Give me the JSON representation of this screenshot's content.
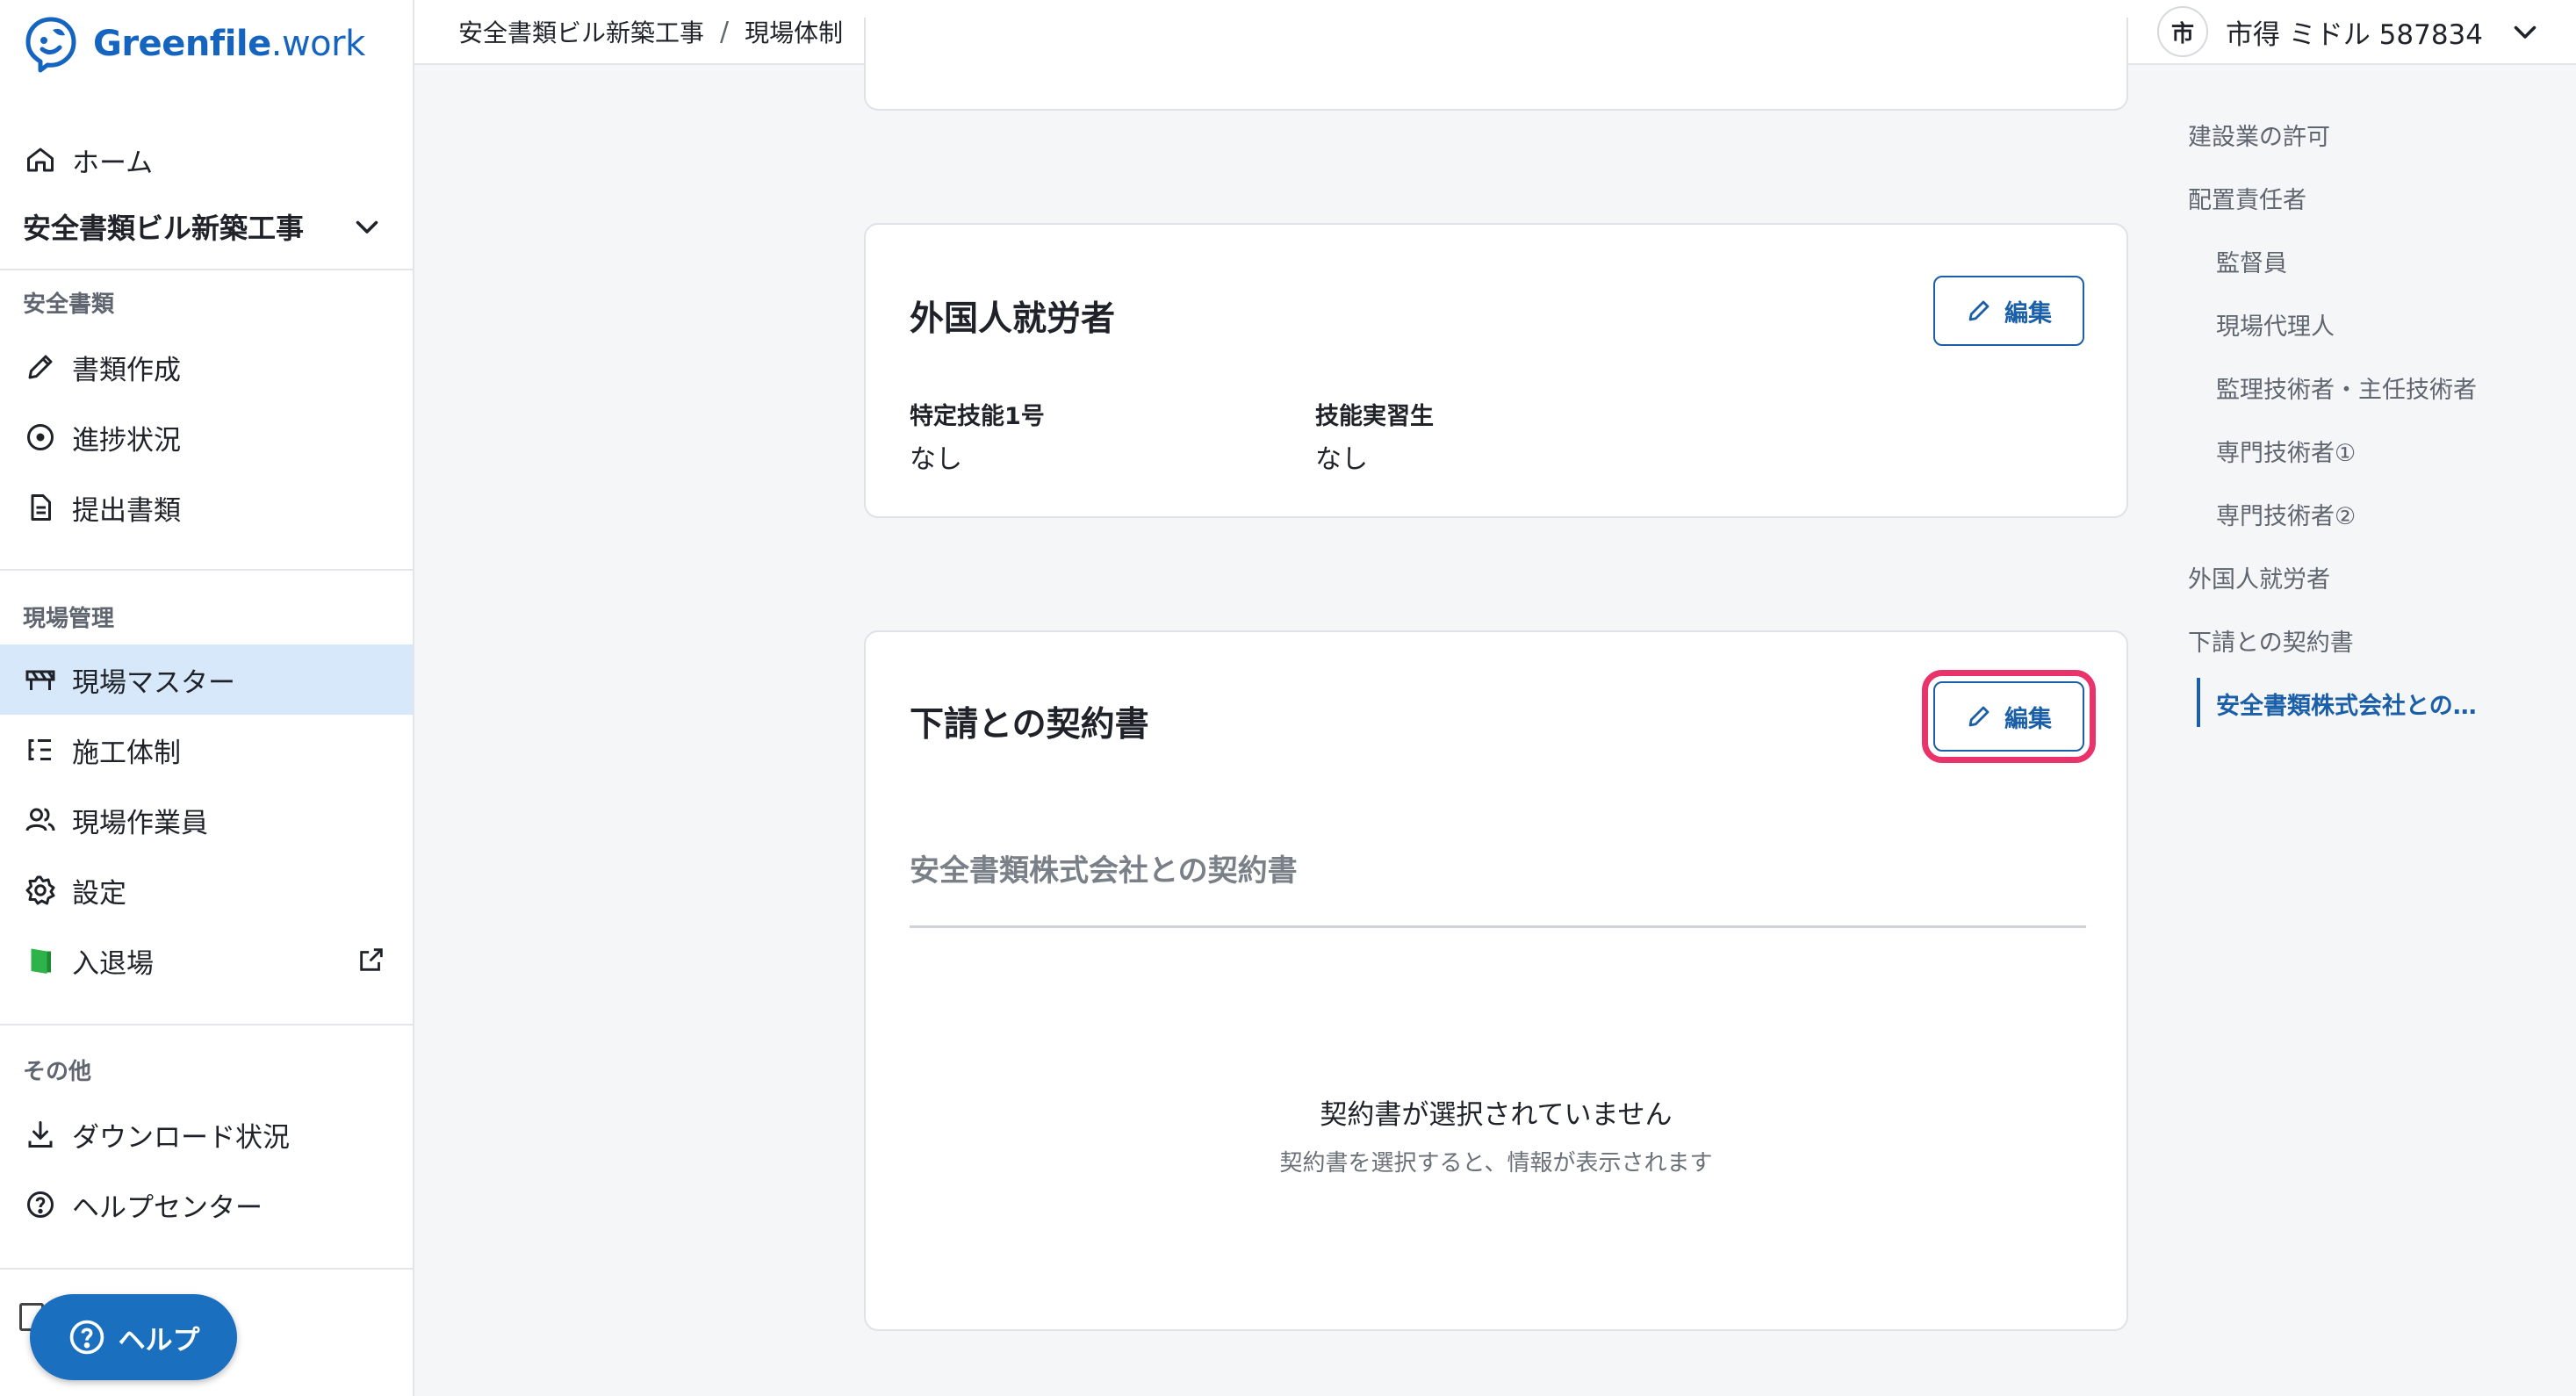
{
  "app": {
    "logo_text_bold": "Greenfile",
    "logo_text_light": ".work"
  },
  "sidebar": {
    "home": "ホーム",
    "project": "安全書類ビル新築工事",
    "sections": {
      "safety": "安全書類",
      "site": "現場管理",
      "other": "その他"
    },
    "safety_items": [
      "書類作成",
      "進捗状況",
      "提出書類"
    ],
    "site_items": [
      "現場マスター",
      "施工体制",
      "現場作業員",
      "設定",
      "入退場"
    ],
    "other_items": [
      "ダウンロード状況",
      "ヘルプセンター"
    ],
    "help_button": "ヘルプ"
  },
  "topbar": {
    "breadcrumb": [
      "安全書類ビル新築工事",
      "現場体制"
    ],
    "breadcrumb_sep": "/",
    "user_avatar": "市",
    "user_name": "市得 ミドル 587834"
  },
  "cards": {
    "foreign": {
      "title": "外国人就労者",
      "edit_label": "編集",
      "fields": [
        {
          "label": "特定技能1号",
          "value": "なし"
        },
        {
          "label": "技能実習生",
          "value": "なし"
        }
      ]
    },
    "contract": {
      "title": "下請との契約書",
      "edit_label": "編集",
      "tab_label": "安全書類株式会社との契約書",
      "empty_title": "契約書が選択されていません",
      "empty_sub": "契約書を選択すると、情報が表示されます"
    }
  },
  "toc": {
    "items": [
      "建設業の許可",
      "配置責任者",
      "監督員",
      "現場代理人",
      "監理技術者・主任技術者",
      "専門技術者①",
      "専門技術者②",
      "外国人就労者",
      "下請との契約書",
      "安全書類株式会社との…"
    ]
  },
  "colors": {
    "accent": "#1a5fa8",
    "active_nav_bg": "#d7e8fb",
    "highlight": "#e8336b",
    "brand_green": "#2db34a"
  }
}
